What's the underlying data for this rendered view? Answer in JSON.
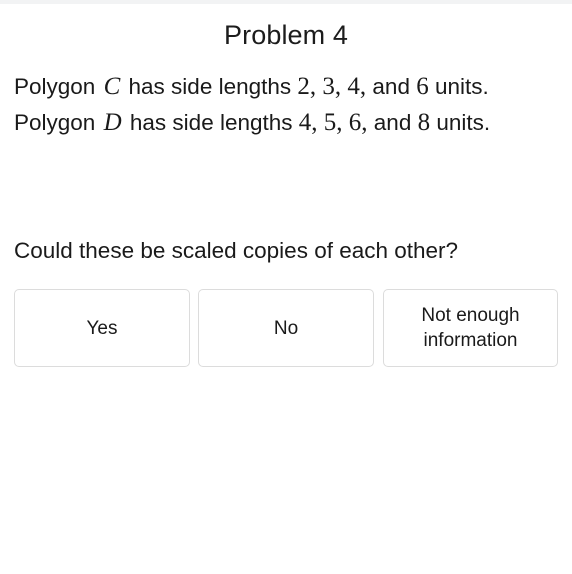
{
  "page": {
    "background_color": "#ffffff",
    "text_color": "#1a1a1a",
    "top_strip_color": "#f2f3f4"
  },
  "header": {
    "title": "Problem 4"
  },
  "statement": {
    "lines": [
      {
        "id": "polygon-c",
        "prefix": "Polygon",
        "variable": "C",
        "middle": "has side lengths",
        "values": "2, 3, 4,",
        "connector": "and",
        "last_value": "6",
        "suffix": "units.",
        "full_text": "Polygon C has side lengths 2, 3, 4, and 6 units."
      },
      {
        "id": "polygon-d",
        "prefix": "Polygon",
        "variable": "D",
        "middle": "has side lengths",
        "values": "4, 5, 6,",
        "connector": "and",
        "last_value": "8",
        "suffix": "units.",
        "full_text": "Polygon D has side lengths 4, 5, 6, and 8 units."
      }
    ]
  },
  "question": {
    "text": "Could these be scaled copies of each other?"
  },
  "choices": {
    "border_color": "#dcdcdc",
    "items": [
      {
        "id": "yes",
        "label": "Yes"
      },
      {
        "id": "no",
        "label": "No"
      },
      {
        "id": "not-enough-information",
        "label": "Not enough\ninformation"
      }
    ]
  }
}
